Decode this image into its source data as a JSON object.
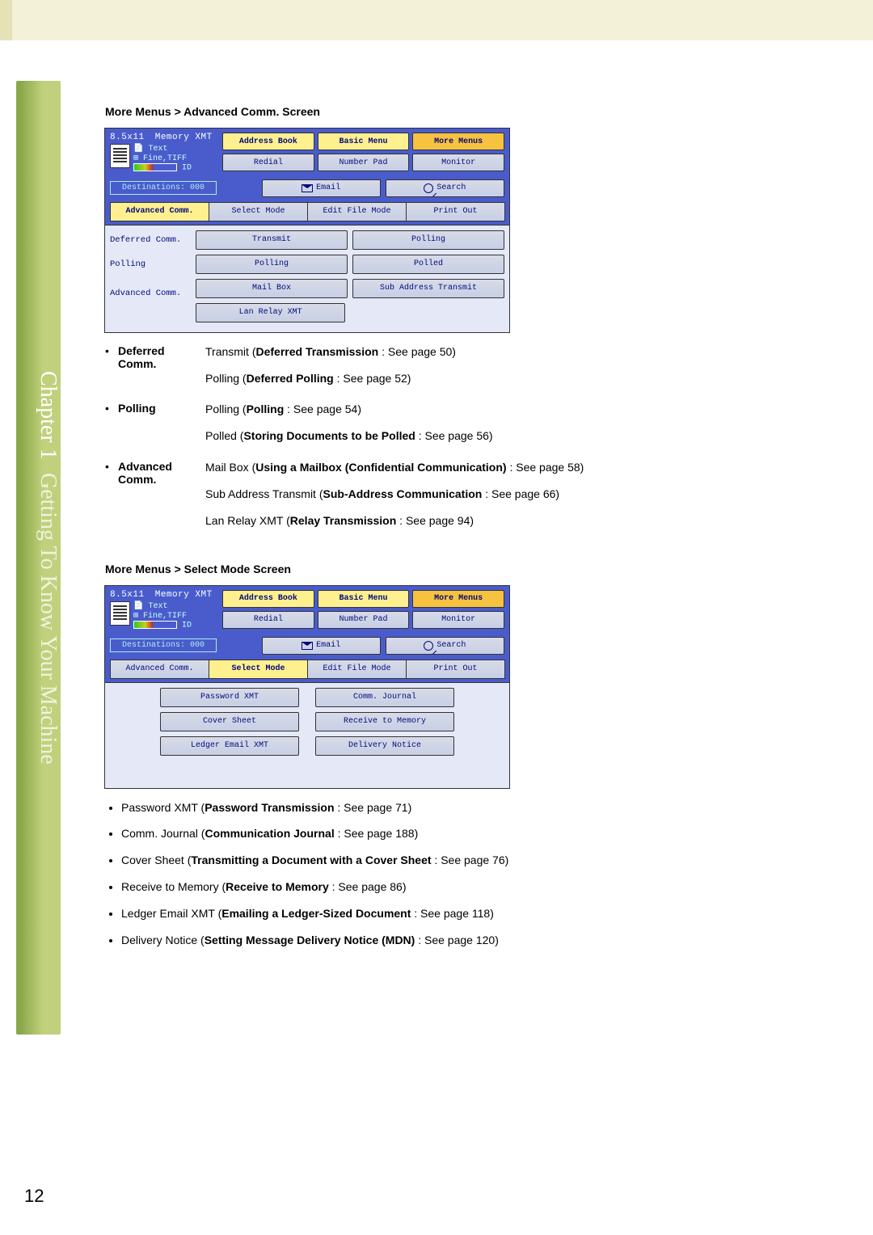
{
  "chapter_tab": "Chapter 1",
  "chapter_title": "Getting To Know Your Machine",
  "page_number": "12",
  "section1": {
    "heading": "More Menus > Advanced Comm. Screen",
    "screen": {
      "size": "8.5x11",
      "mode": "Memory XMT",
      "text": "Text",
      "quality": "Fine,TIFF",
      "id": "ID",
      "destinations": "Destinations: 000",
      "top_buttons_r1": [
        "Address Book",
        "Basic Menu",
        "More Menus"
      ],
      "top_buttons_r2": [
        "Redial",
        "Number Pad",
        "Monitor"
      ],
      "dest_buttons": [
        "Email",
        "Search"
      ],
      "tabs": [
        "Advanced Comm.",
        "Select Mode",
        "Edit File Mode",
        "Print Out"
      ],
      "active_tab": 0,
      "rows": [
        {
          "label": "Deferred Comm.",
          "btns": [
            "Transmit",
            "Polling"
          ]
        },
        {
          "label": "Polling",
          "btns": [
            "Polling",
            "Polled"
          ]
        },
        {
          "label": "Advanced Comm.",
          "btns2": [
            [
              "Mail Box",
              "Sub Address Transmit"
            ],
            [
              "Lan Relay XMT"
            ]
          ]
        }
      ]
    },
    "desc": [
      {
        "term": "Deferred Comm.",
        "lines": [
          {
            "pre": "Transmit (",
            "b": "Deferred Transmission",
            "post": " : See page 50)"
          },
          {
            "pre": "Polling (",
            "b": "Deferred Polling",
            "post": " : See page 52)"
          }
        ]
      },
      {
        "term": "Polling",
        "lines": [
          {
            "pre": "Polling (",
            "b": "Polling",
            "post": " : See page 54)"
          },
          {
            "pre": "Polled (",
            "b": "Storing Documents to be Polled",
            "post": " : See page 56)"
          }
        ]
      },
      {
        "term": "Advanced Comm.",
        "lines": [
          {
            "pre": "Mail Box (",
            "b": "Using a Mailbox (Confidential Communication)",
            "post": " : See page 58)"
          },
          {
            "pre": "Sub Address Transmit (",
            "b": "Sub-Address Communication",
            "post": " : See page 66)"
          },
          {
            "pre": "Lan Relay XMT (",
            "b": "Relay Transmission",
            "post": " : See page 94)"
          }
        ]
      }
    ]
  },
  "section2": {
    "heading": "More Menus > Select Mode Screen",
    "screen": {
      "size": "8.5x11",
      "mode": "Memory XMT",
      "text": "Text",
      "quality": "Fine,TIFF",
      "id": "ID",
      "destinations": "Destinations: 000",
      "top_buttons_r1": [
        "Address Book",
        "Basic Menu",
        "More Menus"
      ],
      "top_buttons_r2": [
        "Redial",
        "Number Pad",
        "Monitor"
      ],
      "dest_buttons": [
        "Email",
        "Search"
      ],
      "tabs": [
        "Advanced Comm.",
        "Select Mode",
        "Edit File Mode",
        "Print Out"
      ],
      "active_tab": 1,
      "pairs": [
        [
          "Password XMT",
          "Comm. Journal"
        ],
        [
          "Cover Sheet",
          "Receive to Memory"
        ],
        [
          "Ledger Email XMT",
          "Delivery Notice"
        ]
      ]
    },
    "bullets": [
      {
        "pre": "Password XMT (",
        "b": "Password Transmission",
        "post": " : See page 71)"
      },
      {
        "pre": "Comm. Journal (",
        "b": "Communication Journal",
        "post": " : See page 188)"
      },
      {
        "pre": "Cover Sheet (",
        "b": "Transmitting a Document with a Cover Sheet",
        "post": " : See page 76)"
      },
      {
        "pre": "Receive to Memory (",
        "b": "Receive to Memory",
        "post": " : See page 86)"
      },
      {
        "pre": "Ledger Email XMT (",
        "b": "Emailing a Ledger-Sized Document",
        "post": " : See page 118)"
      },
      {
        "pre": "Delivery Notice (",
        "b": "Setting Message Delivery Notice (MDN)",
        "post": " : See page 120)"
      }
    ]
  }
}
